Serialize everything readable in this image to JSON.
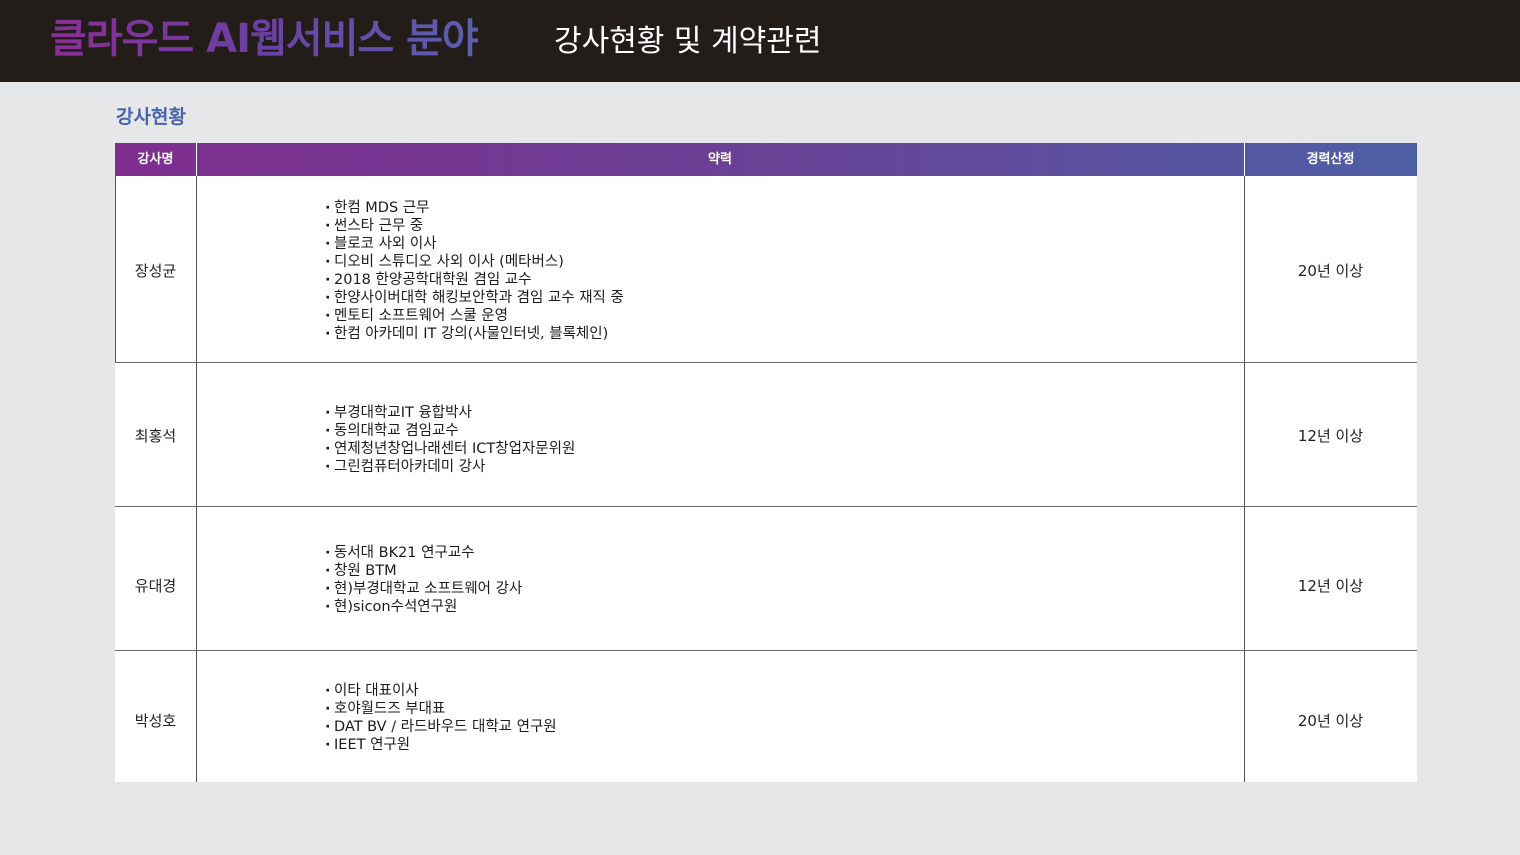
{
  "header": {
    "title_bold": "클라우드 AI웹서비스 분야",
    "title_light": "강사현황 및 계약관련"
  },
  "section": {
    "title": "강사현황"
  },
  "table": {
    "headers": {
      "name": "강사명",
      "career": "약력",
      "years": "경력산정"
    },
    "rows": [
      {
        "name": "장성균",
        "career": [
          "한컴 MDS 근무",
          "썬스타 근무 중",
          "블로코 사외 이사",
          "디오비 스튜디오 사외 이사 (메타버스)",
          "2018 한양공학대학원 겸임 교수",
          "한양사이버대학 해킹보안학과 겸임 교수 재직 중",
          "멘토티 소프트웨어 스쿨 운영",
          "한컴 아카데미 IT 강의(사물인터넷, 블록체인)"
        ],
        "years": "20년 이상"
      },
      {
        "name": "최홍석",
        "career": [
          "부경대학교IT 융합박사",
          "동의대학교 겸임교수",
          "연제청년창업나래센터 ICT창업자문위원",
          "그린컴퓨터아카데미 강사"
        ],
        "years": "12년 이상"
      },
      {
        "name": "유대경",
        "career": [
          "동서대 BK21 연구교수",
          "창원 BTM",
          "현)부경대학교 소프트웨어 강사",
          "현)sicon수석연구원"
        ],
        "years": "12년 이상"
      },
      {
        "name": "박성호",
        "career": [
          "이타 대표이사",
          "호야월드즈 부대표",
          "DAT BV / 라드바우드 대학교 연구원",
          "IEET 연구원"
        ],
        "years": "20년 이상"
      }
    ]
  }
}
